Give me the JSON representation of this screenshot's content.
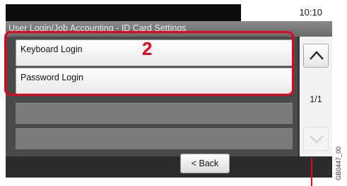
{
  "status": {
    "time": "10:10"
  },
  "header": {
    "title": "User Login/Job Accounting - ID Card Settings"
  },
  "list": {
    "items": [
      {
        "label": "Keyboard Login"
      },
      {
        "label": "Password Login"
      }
    ]
  },
  "callout": {
    "number": "2"
  },
  "scroll": {
    "page_indicator": "1/1"
  },
  "footer": {
    "back_label": "< Back"
  },
  "figure": {
    "code": "GB0447_00"
  },
  "colors": {
    "callout": "#e2001a"
  }
}
